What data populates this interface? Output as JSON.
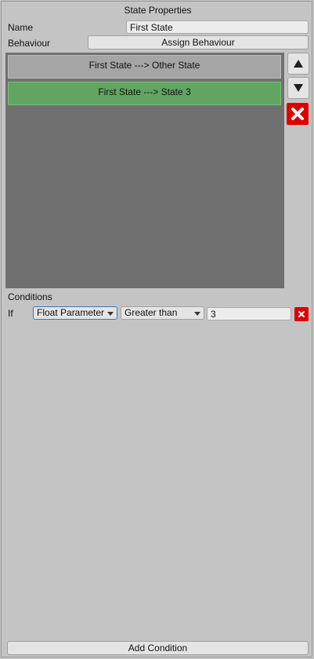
{
  "panel": {
    "title": "State Properties"
  },
  "name_field": {
    "label": "Name",
    "value": "First State"
  },
  "behaviour": {
    "label": "Behaviour",
    "button_label": "Assign Behaviour"
  },
  "transitions": {
    "items": [
      {
        "label": "First State ---> Other State",
        "selected": false
      },
      {
        "label": "First State ---> State 3",
        "selected": true
      }
    ],
    "move_up_icon": "up-arrow",
    "move_down_icon": "down-arrow",
    "delete_icon": "x",
    "selected_color": "#62a562",
    "delete_color": "#df0000"
  },
  "conditions": {
    "heading": "Conditions",
    "rows": [
      {
        "prefix": "If",
        "parameter": "Float Parameter",
        "comparison": "Greater than",
        "value": "3"
      }
    ],
    "add_button_label": "Add Condition"
  }
}
